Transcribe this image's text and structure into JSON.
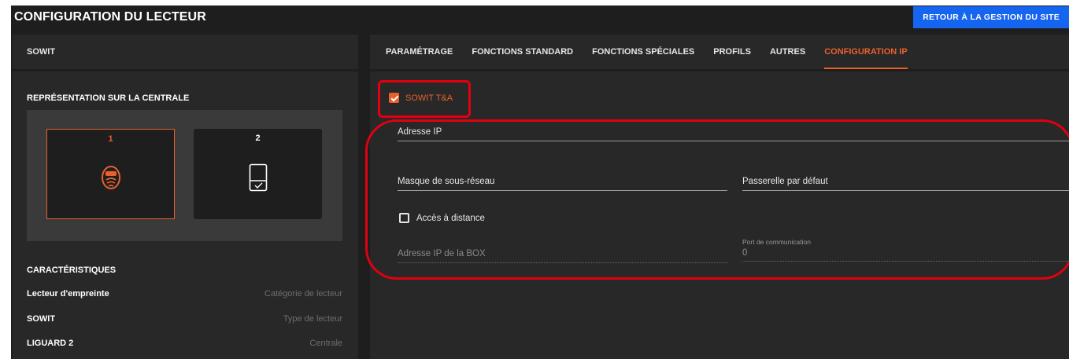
{
  "header": {
    "title": "CONFIGURATION DU LECTEUR",
    "back_button": "RETOUR À LA GESTION DU SITE"
  },
  "left": {
    "panel_title": "SOWIT",
    "representation_title": "REPRÉSENTATION SUR LA CENTRALE",
    "cards": [
      {
        "number": "1",
        "icon": "fingerprint-reader-icon",
        "selected": true
      },
      {
        "number": "2",
        "icon": "badge-reader-icon",
        "selected": false
      }
    ],
    "characteristics_title": "CARACTÉRISTIQUES",
    "characteristics": [
      {
        "value": "Lecteur d'empreinte",
        "label": "Catégorie de lecteur"
      },
      {
        "value": "SOWIT",
        "label": "Type de lecteur"
      },
      {
        "value": "LIGUARD 2",
        "label": "Centrale"
      }
    ]
  },
  "tabs": [
    {
      "label": "PARAMÉTRAGE"
    },
    {
      "label": "FONCTIONS STANDARD"
    },
    {
      "label": "FONCTIONS SPÉCIALES"
    },
    {
      "label": "PROFILS"
    },
    {
      "label": "AUTRES"
    },
    {
      "label": "CONFIGURATION IP",
      "active": true
    }
  ],
  "ip_config": {
    "sowit_ta_label": "SOWIT T&A",
    "sowit_ta_checked": true,
    "ip_address_label": "Adresse IP",
    "subnet_mask_label": "Masque de sous-réseau",
    "gateway_label": "Passerelle par défaut",
    "remote_access_label": "Accès à distance",
    "remote_access_checked": false,
    "box_ip_label": "Adresse IP de la BOX",
    "port_label": "Port de communication",
    "port_value": "0"
  },
  "colors": {
    "accent": "#e8612c",
    "primary_button": "#1565f0",
    "highlight": "#e2000f",
    "panel": "#282828",
    "background": "#1e1e1e"
  }
}
